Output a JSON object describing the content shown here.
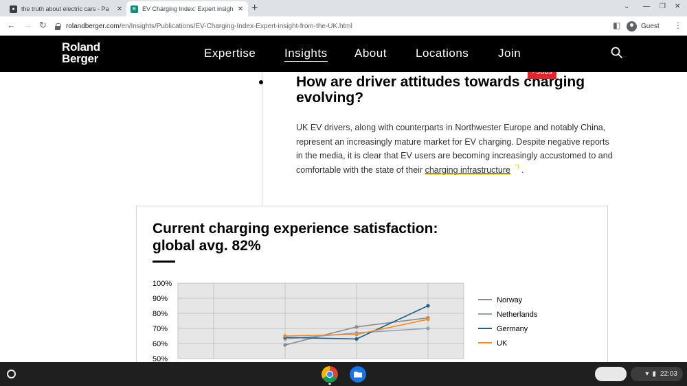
{
  "browser": {
    "tabs": [
      {
        "title": "the truth about electric cars - Pa",
        "favicon_color": "#3c3c3c",
        "active": false
      },
      {
        "title": "EV Charging Index: Expert insigh",
        "favicon_color": "#0f8f7b",
        "active": true
      }
    ],
    "new_tab": "+",
    "url_host": "rolandberger.com",
    "url_path": "/en/Insights/Publications/EV-Charging-Index-Expert-insight-from-the-UK.html",
    "profile_label": "Guest"
  },
  "site": {
    "logo_line1": "Roland",
    "logo_line2": "Berger",
    "nav": [
      "Expertise",
      "Insights",
      "About",
      "Locations",
      "Join"
    ],
    "active_nav": "Insights"
  },
  "article": {
    "jobs_label": "› Jobs",
    "heading": "How are driver attitudes towards charging evolving?",
    "paragraph": "UK EV drivers, along with counterparts in Northwester Europe and notably China, represent an increasingly mature market for EV charging. Despite negative reports in the media, it is clear that EV users are becoming increasingly accustomed to and comfortable with the state of their",
    "link_text": "charging infrastructure",
    "paragraph_end": "."
  },
  "chart_card": {
    "title_line1": "Current charging experience satisfaction:",
    "title_line2": "global avg. 82%"
  },
  "chart_data": {
    "type": "line",
    "title": "Current charging experience satisfaction: global avg. 82%",
    "y_ticks": [
      "100%",
      "90%",
      "80%",
      "70%",
      "60%",
      "50%"
    ],
    "ylim": [
      50,
      100
    ],
    "x_points": 3,
    "grid": true,
    "legend_position": "right",
    "series": [
      {
        "name": "Norway",
        "color": "#8c8c8c",
        "values": [
          59,
          71,
          77
        ]
      },
      {
        "name": "Netherlands",
        "color": "#8ea2b8",
        "values": [
          63,
          67,
          70
        ]
      },
      {
        "name": "Germany",
        "color": "#1f5f8b",
        "values": [
          64,
          63,
          85
        ]
      },
      {
        "name": "UK",
        "color": "#f28c28",
        "values": [
          65,
          66,
          76
        ]
      }
    ]
  },
  "shelf": {
    "time": "22:03"
  }
}
